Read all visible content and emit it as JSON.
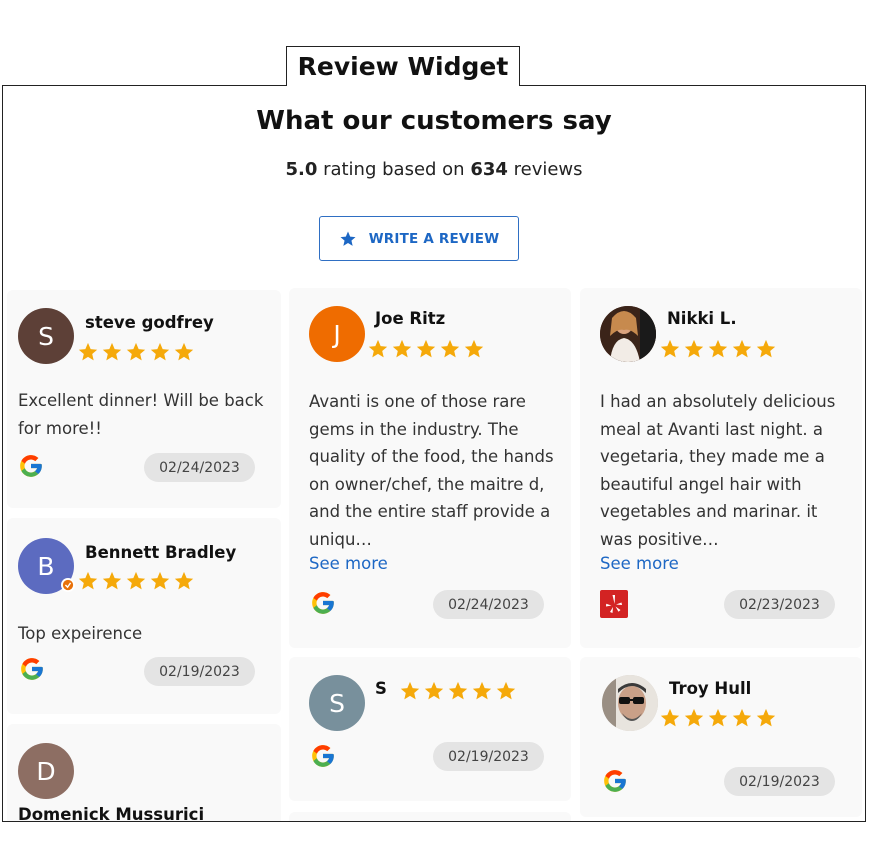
{
  "widget": {
    "tab_title": "Review Widget",
    "heading": "What our customers say",
    "rating_value": "5.0",
    "rating_mid": " rating based on ",
    "review_count": "634",
    "rating_suffix": " reviews",
    "write_button_label": "WRITE A REVIEW",
    "star_color": "#f5a90a",
    "accent_color": "#1d67c4"
  },
  "reviews": [
    {
      "name": "steve godfrey",
      "initial": "S",
      "avatar_color": "#5d4037",
      "rating": 5,
      "text_lines": [
        "Excellent dinner! Will be back",
        "for more!!"
      ],
      "source": "google-icon",
      "date": "02/24/2023"
    },
    {
      "name": "Joe Ritz",
      "initial": "J",
      "avatar_color": "#ef6c00",
      "rating": 5,
      "text_lines": [
        "Avanti is one of those rare",
        "gems in the industry. The",
        "quality of the food, the hands",
        "on owner/chef, the maitre d,",
        "and the entire staff provide a",
        "uniqu…"
      ],
      "see_more": "See more",
      "source": "google-icon",
      "date": "02/24/2023"
    },
    {
      "name": "Nikki L.",
      "initial": "",
      "avatar_color": "#5a3a2e",
      "rating": 5,
      "text_lines": [
        "I had an absolutely delicious",
        "meal at Avanti last night. a",
        "vegetaria, they made me a",
        "beautiful angel hair with",
        "vegetables and marinar. it",
        "was positive…"
      ],
      "see_more": "See more",
      "source": "yelp-icon",
      "date": "02/23/2023"
    },
    {
      "name": "Bennett Bradley",
      "initial": "B",
      "avatar_color": "#5c6bc0",
      "rating": 5,
      "text_lines": [
        "Top expeirence"
      ],
      "source": "google-icon",
      "date": "02/19/2023"
    },
    {
      "name": "S",
      "initial": "S",
      "avatar_color": "#78909c",
      "rating": 5,
      "text_lines": [],
      "source": "google-icon",
      "date": "02/19/2023"
    },
    {
      "name": "Troy Hull",
      "initial": "",
      "avatar_color": "#8a7a70",
      "rating": 5,
      "text_lines": [],
      "source": "google-icon",
      "date": "02/19/2023"
    },
    {
      "name": "Domenick Mussurici",
      "initial": "D",
      "avatar_color": "#8d6e63"
    }
  ]
}
